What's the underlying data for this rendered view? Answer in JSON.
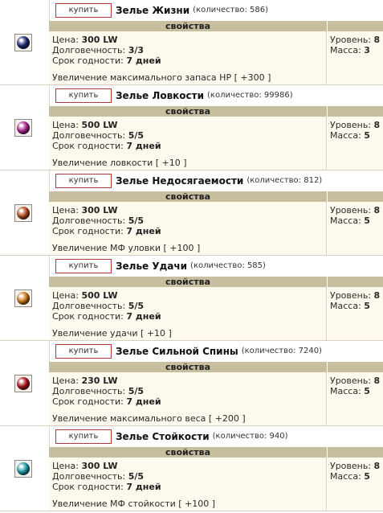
{
  "buy_label": "купить",
  "properties_label": "свойства",
  "labels": {
    "price": "Цена: ",
    "durability": "Долговечность: ",
    "expiry": "Срок годности: ",
    "level": "Уровень: ",
    "mass": "Масса: "
  },
  "items": [
    {
      "name": "Зелье Жизни",
      "qty": "(количество: 586)",
      "price": "300 LW",
      "durability": "3/3",
      "expiry": "7 дней",
      "effect": "Увеличение максимального запаса HP [ +300 ]",
      "level": "8",
      "mass": "3",
      "icon": "potion-of-life-icon",
      "color": "#1f2a7a"
    },
    {
      "name": "Зелье Ловкости",
      "qty": "(количество: 99986)",
      "price": "500 LW",
      "durability": "5/5",
      "expiry": "7 дней",
      "effect": "Увеличение ловкости [ +10 ]",
      "level": "8",
      "mass": "5",
      "icon": "potion-of-agility-icon",
      "color": "#b3289a"
    },
    {
      "name": "Зелье Недосягаемости",
      "qty": "(количество: 812)",
      "price": "300 LW",
      "durability": "5/5",
      "expiry": "7 дней",
      "effect": "Увеличение МФ уловки [ +100 ]",
      "level": "8",
      "mass": "5",
      "icon": "potion-of-evasion-icon",
      "color": "#c0501c"
    },
    {
      "name": "Зелье Удачи",
      "qty": "(количество: 585)",
      "price": "500 LW",
      "durability": "5/5",
      "expiry": "7 дней",
      "effect": "Увеличение удачи [ +10 ]",
      "level": "8",
      "mass": "5",
      "icon": "potion-of-luck-icon",
      "color": "#d9821a"
    },
    {
      "name": "Зелье Сильной Спины",
      "qty": "(количество: 7240)",
      "price": "230 LW",
      "durability": "5/5",
      "expiry": "7 дней",
      "effect": "Увеличение максимального веса [ +200 ]",
      "level": "8",
      "mass": "5",
      "icon": "potion-of-strong-back-icon",
      "color": "#b3171c"
    },
    {
      "name": "Зелье Стойкости",
      "qty": "(количество: 940)",
      "price": "300 LW",
      "durability": "5/5",
      "expiry": "7 дней",
      "effect": "Увеличение МФ стойкости [ +100 ]",
      "level": "8",
      "mass": "5",
      "icon": "potion-of-resilience-icon",
      "color": "#1fa7b3"
    }
  ]
}
